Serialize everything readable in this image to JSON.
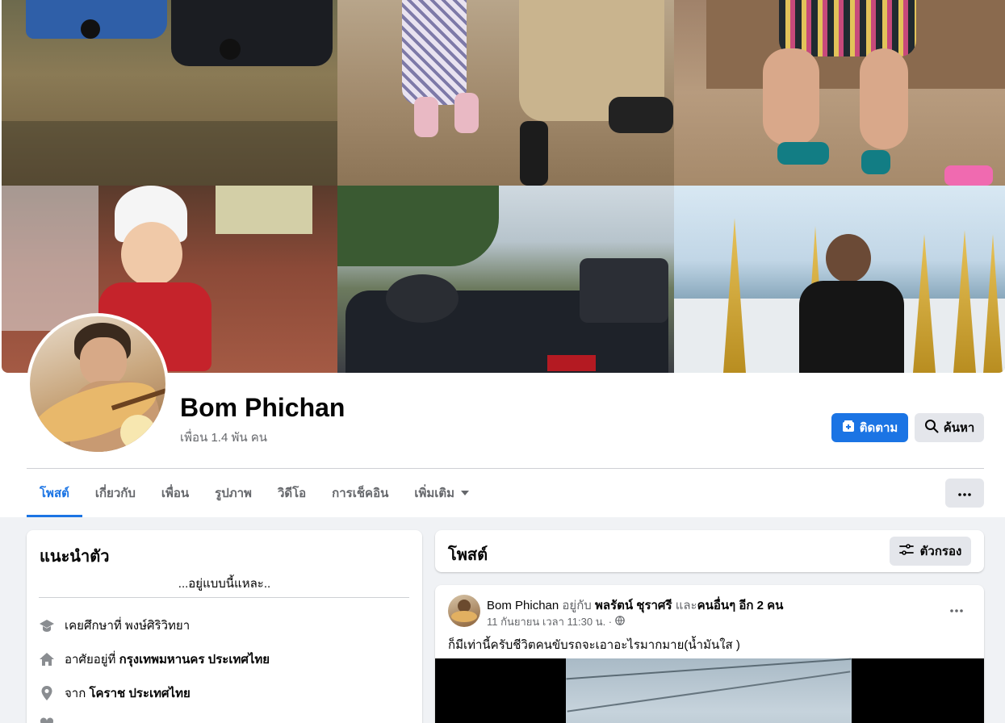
{
  "profile": {
    "name": "Bom Phichan",
    "friends": "เพื่อน 1.4 พัน คน"
  },
  "actions": {
    "follow_label": "ติดตาม",
    "search_label": "ค้นหา"
  },
  "tabs": [
    {
      "label": "โพสต์",
      "active": true
    },
    {
      "label": "เกี่ยวกับ",
      "active": false
    },
    {
      "label": "เพื่อน",
      "active": false
    },
    {
      "label": "รูปภาพ",
      "active": false
    },
    {
      "label": "วิดีโอ",
      "active": false
    },
    {
      "label": "การเช็คอิน",
      "active": false
    },
    {
      "label": "เพิ่มเติม",
      "active": false
    }
  ],
  "intro": {
    "title": "แนะนำตัว",
    "bio": "...อยู่แบบนี้แหละ..",
    "items": [
      {
        "icon": "graduation-cap-icon",
        "prefix": "เคยศึกษาที่ ",
        "value": "พงษ์ศิริวิทยา",
        "bold": false
      },
      {
        "icon": "home-icon",
        "prefix": "อาศัยอยู่ที่ ",
        "value": "กรุงเทพมหานคร ประเทศไทย",
        "bold": true
      },
      {
        "icon": "location-pin-icon",
        "prefix": "จาก ",
        "value": "โคราช ประเทศไทย",
        "bold": true
      }
    ]
  },
  "posts_header": {
    "title": "โพสต์",
    "filter_label": "ตัวกรอง"
  },
  "post": {
    "author": "Bom Phichan",
    "with_text": "อยู่กับ",
    "tagged": "พลรัตน์ ชุราศรี",
    "and_text": "และ",
    "others": "คนอื่นๆ อีก 2 คน",
    "time": "11 กันยายน เวลา 11:30 น. ·",
    "text": "ก็มีเท่านี้ครับชีวิตคนขับรถจะเอาอะไรมากมาย(น้ำมันใส )"
  },
  "colors": {
    "accent": "#1b74e4",
    "muted_text": "#65676b",
    "button_gray": "#e4e6eb",
    "page_bg": "#f0f2f5"
  }
}
